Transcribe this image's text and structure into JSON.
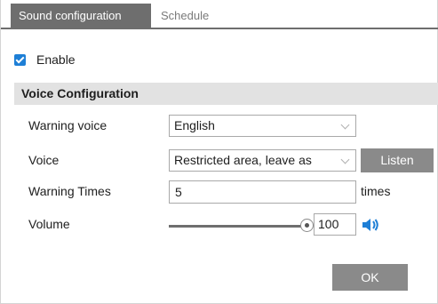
{
  "tabs": [
    {
      "label": "Sound configuration",
      "active": true
    },
    {
      "label": "Schedule",
      "active": false
    }
  ],
  "enable": {
    "label": "Enable",
    "checked": true
  },
  "section": {
    "title": "Voice Configuration"
  },
  "warning_voice": {
    "label": "Warning voice",
    "value": "English"
  },
  "voice": {
    "label": "Voice",
    "value": "Restricted area, leave as",
    "button": "Listen"
  },
  "warning_times": {
    "label": "Warning Times",
    "value": "5",
    "unit": "times"
  },
  "volume": {
    "label": "Volume",
    "value": "100",
    "level": 1.0
  },
  "ok_button": "OK",
  "colors": {
    "tab_active": "#6e6e6e",
    "checkbox": "#1e7fd6",
    "button": "#8a8a8a",
    "speaker": "#1e7fd6"
  },
  "icons": {
    "volume": "speaker-icon",
    "dropdown": "chevron-down-icon",
    "checkbox": "checkmark-icon"
  }
}
